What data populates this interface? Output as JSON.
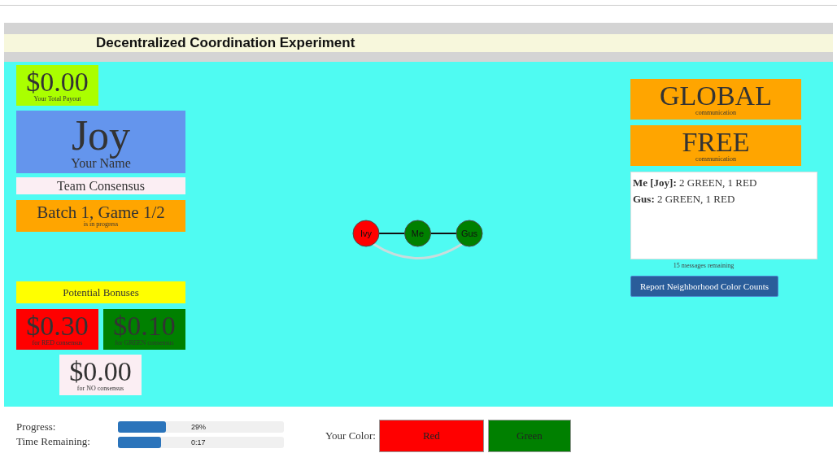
{
  "header": {
    "title": "Decentralized Coordination Experiment"
  },
  "payout": {
    "amount": "$0.00",
    "caption": "Your Total Payout"
  },
  "player": {
    "name": "Joy",
    "caption": "Your Name"
  },
  "mode": "Team Consensus",
  "game": {
    "title": "Batch 1, Game 1/2",
    "caption": "is in progress"
  },
  "bonuses": {
    "title": "Potential Bonuses",
    "items": [
      {
        "amount": "$0.30",
        "caption": "for RED consensus",
        "color": "#ff0000"
      },
      {
        "amount": "$0.10",
        "caption": "for GREEN consensus",
        "color": "#008000"
      },
      {
        "amount": "$0.00",
        "caption": "for NO consensus",
        "color": "#fbeef3"
      }
    ]
  },
  "network": {
    "nodes": [
      {
        "label": "Ivy",
        "color": "#ff0000"
      },
      {
        "label": "Me",
        "color": "#008000"
      },
      {
        "label": "Gus",
        "color": "#008000"
      }
    ]
  },
  "communication": [
    {
      "title": "GLOBAL",
      "caption": "communication"
    },
    {
      "title": "FREE",
      "caption": "communication"
    }
  ],
  "messages": [
    {
      "sender": "Me [Joy]:",
      "text": "2 GREEN, 1 RED"
    },
    {
      "sender": "Gus:",
      "text": "2 GREEN, 1 RED"
    }
  ],
  "messages_remaining": "15 messages remaining",
  "report_button": "Report Neighborhood Color Counts",
  "status": [
    {
      "label": "Progress:",
      "level": 0.29,
      "reading": "29%"
    },
    {
      "label": "Time Remaining:",
      "level": 0.26,
      "reading": "0:17"
    }
  ],
  "color_choice": {
    "label": "Your Color:",
    "options": [
      {
        "label": "Red",
        "color": "#ff0000"
      },
      {
        "label": "Green",
        "color": "#008000"
      }
    ]
  }
}
